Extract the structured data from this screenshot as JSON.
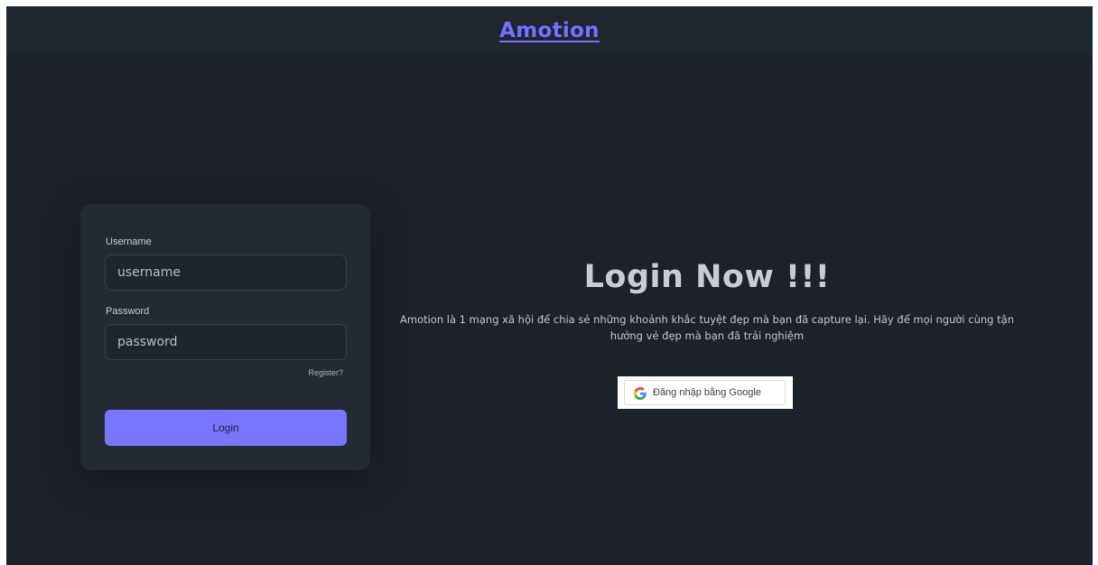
{
  "header": {
    "brand": "Amotion"
  },
  "login_form": {
    "username_label": "Username",
    "username_placeholder": "username",
    "password_label": "Password",
    "password_placeholder": "password",
    "register_link": "Register?",
    "login_button": "Login"
  },
  "hero": {
    "title": "Login Now !!!",
    "description": "Amotion là 1 mạng xã hội để chia sẻ những khoảnh khắc tuyệt đẹp mà bạn đã capture lại. Hãy để mọi người cùng tận hưởng vẻ đẹp mà bạn đã trải nghiệm",
    "google_button": "Đăng nhập bằng Google"
  },
  "colors": {
    "background": "#1d222a",
    "card": "#232a33",
    "accent": "#7a75ff",
    "brand": "#7272ff"
  },
  "icons": {
    "google": "google-g-icon"
  }
}
